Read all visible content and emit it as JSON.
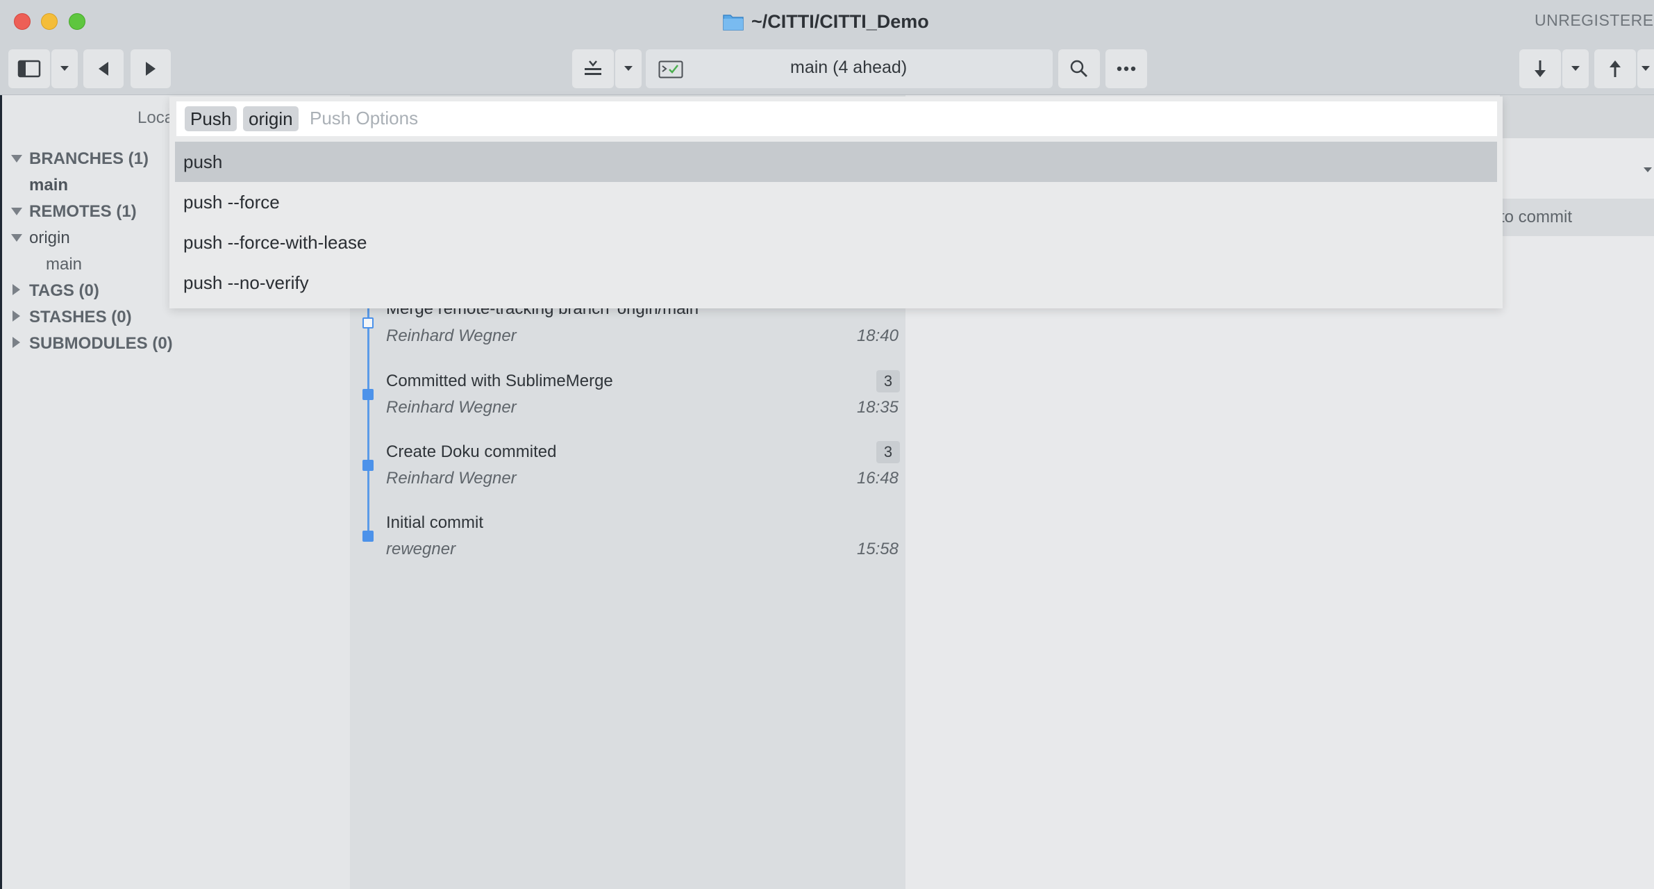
{
  "window": {
    "title": "~/CITTI/CITTI_Demo",
    "unregistered": "UNREGISTERED"
  },
  "toolbar": {
    "branch_status": "main (4 ahead)"
  },
  "sidebar": {
    "location_label": "Loca",
    "sections": [
      {
        "label": "BRANCHES (1)",
        "expanded": true
      },
      {
        "label": "REMOTES (1)",
        "expanded": true
      },
      {
        "label": "TAGS (0)",
        "expanded": false
      },
      {
        "label": "STASHES (0)",
        "expanded": false
      },
      {
        "label": "SUBMODULES (0)",
        "expanded": false
      }
    ],
    "branch_main": "main",
    "remote_origin": "origin",
    "remote_origin_main": "main"
  },
  "commits": [
    {
      "message": "Merge remote-tracking branch 'origin/main'",
      "author": "Reinhard Wegner",
      "time": "18:40",
      "badge": ""
    },
    {
      "message": "Committed with SublimeMerge",
      "author": "Reinhard Wegner",
      "time": "18:35",
      "badge": "3"
    },
    {
      "message": "Create Doku commited",
      "author": "Reinhard Wegner",
      "time": "16:48",
      "badge": "3"
    },
    {
      "message": "Initial commit",
      "author": "rewegner",
      "time": "15:58",
      "badge": ""
    }
  ],
  "right_panel": {
    "to_commit": "to commit"
  },
  "palette": {
    "tokens": [
      "Push",
      "origin"
    ],
    "placeholder": "Push Options",
    "options": [
      "push",
      "push --force",
      "push --force-with-lease",
      "push --no-verify"
    ],
    "selected_index": 0
  },
  "colors": {
    "graph_accent": "#4c92ea",
    "close": "#ed5f56",
    "minimize": "#f4bd3a",
    "maximize": "#5ec63f"
  }
}
